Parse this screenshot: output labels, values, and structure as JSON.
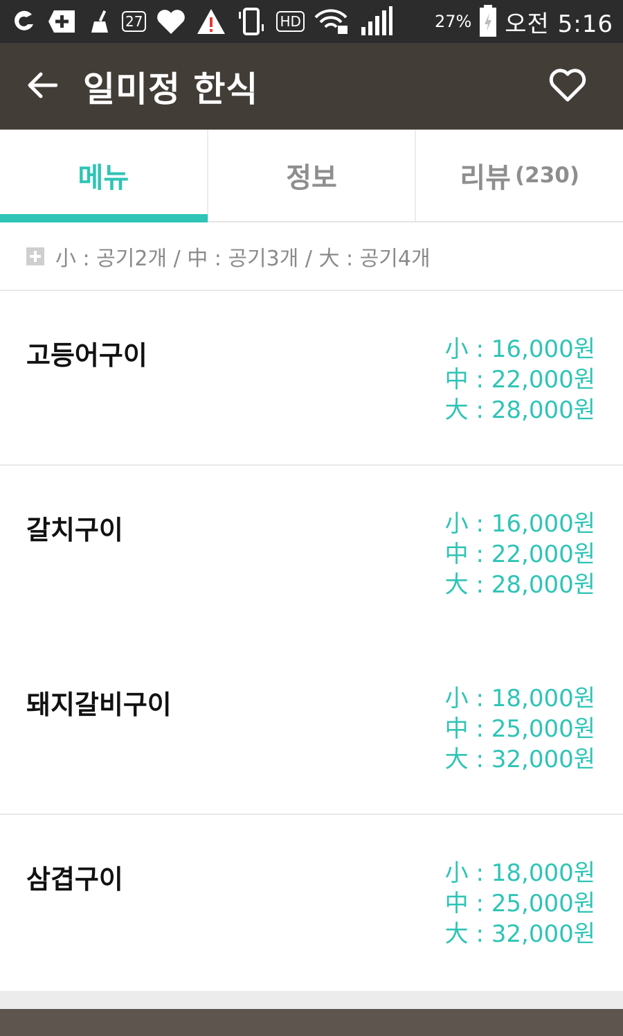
{
  "status_bar": {
    "badge_text": "27",
    "battery_percent": "27%",
    "time": "오전 5:16",
    "hd_label": "HD",
    "icons": [
      "app-circle-icon",
      "plus-square-icon",
      "broom-icon",
      "calendar-badge-icon",
      "heart-icon",
      "warning-icon",
      "phone-vibrate-icon",
      "hd-voice-icon",
      "wifi-lock-icon",
      "signal-icon",
      "battery-charging-icon"
    ]
  },
  "app_bar": {
    "title": "일미정 한식",
    "back_icon": "arrow-left-icon",
    "favorite_icon": "heart-outline-icon"
  },
  "tabs": [
    {
      "label": "메뉴",
      "active": true
    },
    {
      "label": "정보",
      "active": false
    },
    {
      "label": "리뷰",
      "count": "(230)",
      "active": false
    }
  ],
  "legend": {
    "text": "小 : 공기2개 / 中 : 공기3개 / 大 : 공기4개"
  },
  "menu": [
    {
      "name": "고등어구이",
      "prices": [
        "小 : 16,000원",
        "中 : 22,000원",
        "大 : 28,000원"
      ]
    },
    {
      "name": "갈치구이",
      "prices": [
        "小 : 16,000원",
        "中 : 22,000원",
        "大 : 28,000원"
      ]
    },
    {
      "name": "돼지갈비구이",
      "prices": [
        "小 : 18,000원",
        "中 : 25,000원",
        "大 : 32,000원"
      ]
    },
    {
      "name": "삼겹구이",
      "prices": [
        "小 : 18,000원",
        "中 : 25,000원",
        "大 : 32,000원"
      ]
    }
  ],
  "colors": {
    "accent": "#2ec4b6",
    "app_bar": "#433d38",
    "status_bar": "#2c2c2c",
    "bottom_bar": "#5d554e"
  }
}
